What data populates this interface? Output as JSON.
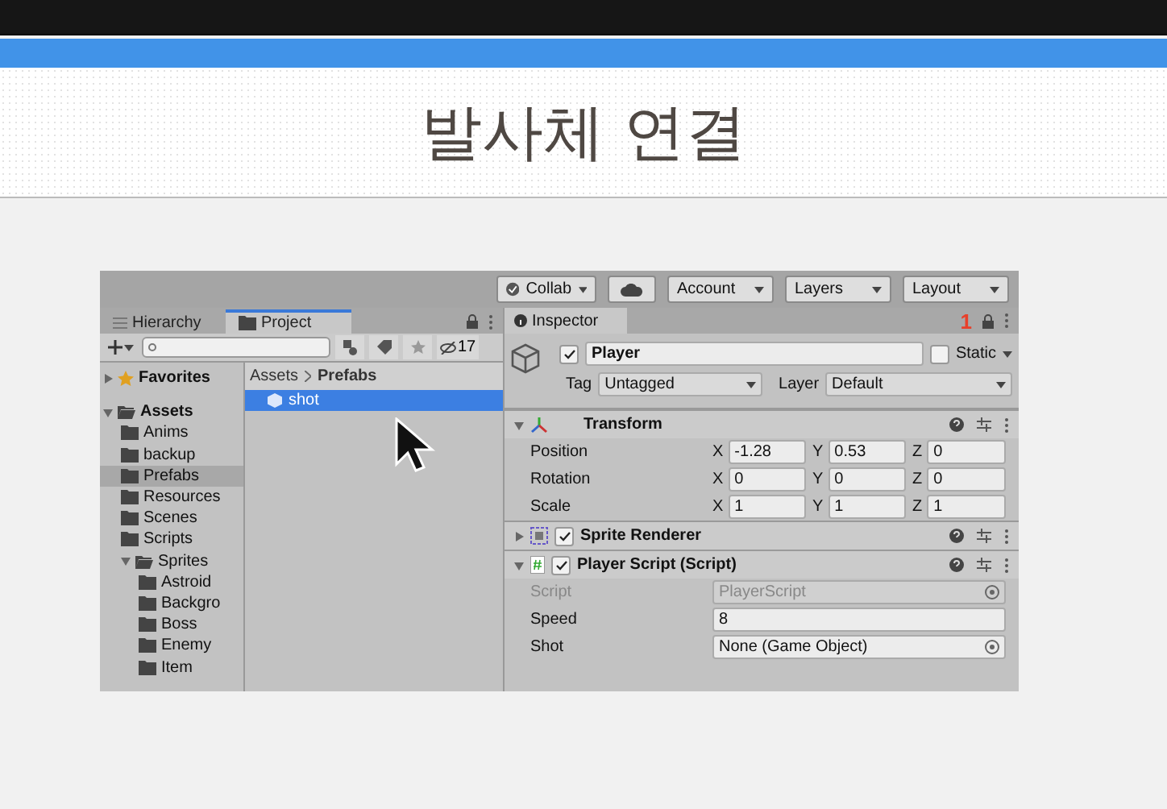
{
  "slide": {
    "title": "발사체 연결"
  },
  "toolbar": {
    "buttons": [
      {
        "kind": "collab",
        "label": "Collab"
      },
      {
        "kind": "cloud"
      },
      {
        "kind": "dropdown",
        "label": "Account"
      },
      {
        "kind": "dropdown",
        "label": "Layers"
      },
      {
        "kind": "dropdown",
        "label": "Layout"
      }
    ]
  },
  "left_tabs": [
    {
      "label": "Hierarchy",
      "kind": "list",
      "selected": false
    },
    {
      "label": "Project",
      "kind": "folder",
      "selected": true
    }
  ],
  "project_toolbar": {
    "hidden_count": "17"
  },
  "folder_tree": [
    {
      "label": "Favorites",
      "kind": "favorites",
      "expanded": false,
      "selected": false
    },
    {
      "label": "Assets",
      "kind": "folder",
      "expanded": true,
      "selected": false,
      "children": [
        {
          "label": "Anims",
          "kind": "folder",
          "selected": false
        },
        {
          "label": "backup",
          "kind": "folder",
          "selected": false
        },
        {
          "label": "Prefabs",
          "kind": "folder",
          "selected": true
        },
        {
          "label": "Resources",
          "kind": "folder",
          "selected": false
        },
        {
          "label": "Scenes",
          "kind": "folder",
          "selected": false
        },
        {
          "label": "Scripts",
          "kind": "folder",
          "selected": false
        },
        {
          "label": "Sprites",
          "kind": "folder",
          "expanded": true,
          "selected": false,
          "children": [
            {
              "label": "Astroid",
              "kind": "folder",
              "selected": false
            },
            {
              "label": "Backgro",
              "kind": "folder",
              "selected": false
            },
            {
              "label": "Boss",
              "kind": "folder",
              "selected": false
            },
            {
              "label": "Enemy",
              "kind": "folder",
              "selected": false
            },
            {
              "label": "Item",
              "kind": "folder",
              "selected": false
            }
          ]
        }
      ]
    }
  ],
  "breadcrumb": [
    "Assets",
    "Prefabs"
  ],
  "files": [
    {
      "label": "shot",
      "selected": true
    }
  ],
  "inspector": {
    "tab": "Inspector",
    "badge": "1",
    "object": {
      "name": "Player",
      "active": true,
      "static": false,
      "static_label": "Static",
      "tag_label": "Tag",
      "tag": "Untagged",
      "layer_label": "Layer",
      "layer": "Default"
    }
  },
  "components": [
    {
      "kind": "transform",
      "title": "Transform",
      "expanded": true,
      "rows": [
        {
          "label": "Position",
          "fields": [
            {
              "axis": "X",
              "value": "-1.28"
            },
            {
              "axis": "Y",
              "value": "0.53"
            },
            {
              "axis": "Z",
              "value": "0"
            }
          ]
        },
        {
          "label": "Rotation",
          "fields": [
            {
              "axis": "X",
              "value": "0"
            },
            {
              "axis": "Y",
              "value": "0"
            },
            {
              "axis": "Z",
              "value": "0"
            }
          ]
        },
        {
          "label": "Scale",
          "fields": [
            {
              "axis": "X",
              "value": "1"
            },
            {
              "axis": "Y",
              "value": "1"
            },
            {
              "axis": "Z",
              "value": "1"
            }
          ]
        }
      ]
    },
    {
      "kind": "sprite",
      "title": "Sprite Renderer",
      "expanded": false,
      "enabled": true
    },
    {
      "kind": "script",
      "title": "Player Script (Script)",
      "expanded": true,
      "enabled": true,
      "properties": [
        {
          "label": "Script",
          "value": "PlayerScript",
          "kind": "object",
          "disabled": true
        },
        {
          "label": "Speed",
          "value": "8",
          "kind": "text",
          "disabled": false
        },
        {
          "label": "Shot",
          "value": "None (Game Object)",
          "kind": "object",
          "disabled": false
        }
      ]
    }
  ]
}
